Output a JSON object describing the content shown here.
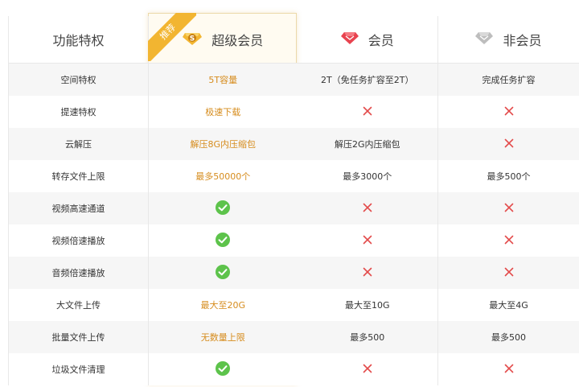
{
  "ribbon": "推荐",
  "header": {
    "feature": "功能特权",
    "super": "超级会员",
    "member": "会员",
    "nonmember": "非会员"
  },
  "icons": {
    "super_icon": "gold-s-badge-icon",
    "member_icon": "red-diamond-icon",
    "nonmember_icon": "gray-diamond-icon",
    "yes_icon": "green-check-icon",
    "no_icon": "red-x-icon"
  },
  "colors": {
    "super_accent": "#f2b531",
    "super_text": "#d68c1d",
    "check": "#5dc34b",
    "cross": "#e34b4b"
  },
  "rows": [
    {
      "feature": "空间特权",
      "super": "5T容量",
      "member": "2T（免任务扩容至2T）",
      "nonmember": "完成任务扩容"
    },
    {
      "feature": "提速特权",
      "super": "极速下载",
      "member": "no",
      "nonmember": "no"
    },
    {
      "feature": "云解压",
      "super": "解压8G内压缩包",
      "member": "解压2G内压缩包",
      "nonmember": "no"
    },
    {
      "feature": "转存文件上限",
      "super": "最多50000个",
      "member": "最多3000个",
      "nonmember": "最多500个"
    },
    {
      "feature": "视频高速通道",
      "super": "yes",
      "member": "no",
      "nonmember": "no"
    },
    {
      "feature": "视频倍速播放",
      "super": "yes",
      "member": "no",
      "nonmember": "no"
    },
    {
      "feature": "音频倍速播放",
      "super": "yes",
      "member": "no",
      "nonmember": "no"
    },
    {
      "feature": "大文件上传",
      "super": "最大至20G",
      "member": "最大至10G",
      "nonmember": "最大至4G"
    },
    {
      "feature": "批量文件上传",
      "super": "无数量上限",
      "member": "最多500",
      "nonmember": "最多500"
    },
    {
      "feature": "垃圾文件清理",
      "super": "yes",
      "member": "no",
      "nonmember": "no"
    }
  ]
}
